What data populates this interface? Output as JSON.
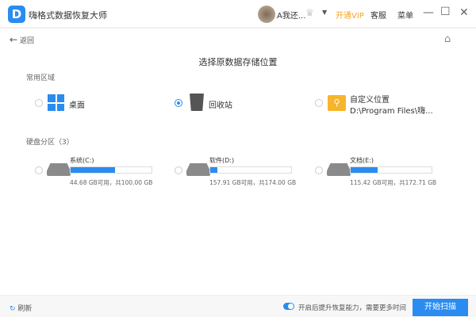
{
  "titlebar": {
    "logo": "D",
    "title": "嗨格式数据恢复大师",
    "user": "A我还...",
    "vip": "开通VIP",
    "support": "客服",
    "menu": "菜单"
  },
  "nav": {
    "back": "返回"
  },
  "heading": "选择原数据存储位置",
  "common": {
    "title": "常用区域",
    "items": [
      {
        "label": "桌面",
        "selected": false
      },
      {
        "label": "回收站",
        "selected": true
      },
      {
        "label": "自定义位置",
        "path": "D:\\Program Files\\嗨...",
        "selected": false
      }
    ]
  },
  "disks": {
    "title": "硬盘分区（3）",
    "items": [
      {
        "name": "系统(C:)",
        "info": "44.68 GB可用，共100.00 GB",
        "used_fraction": 0.553
      },
      {
        "name": "软件(D:)",
        "info": "157.91 GB可用，共174.00 GB",
        "used_fraction": 0.092
      },
      {
        "name": "文档(E:)",
        "info": "115.42 GB可用，共172.71 GB",
        "used_fraction": 0.332
      }
    ]
  },
  "footer": {
    "refresh": "刷新",
    "toggle_label": "开启后提升恢复能力，需要更多时间",
    "toggle_on": true,
    "scan": "开始扫描"
  },
  "colors": {
    "accent": "#2a8cf0",
    "vip": "#f5a623"
  }
}
